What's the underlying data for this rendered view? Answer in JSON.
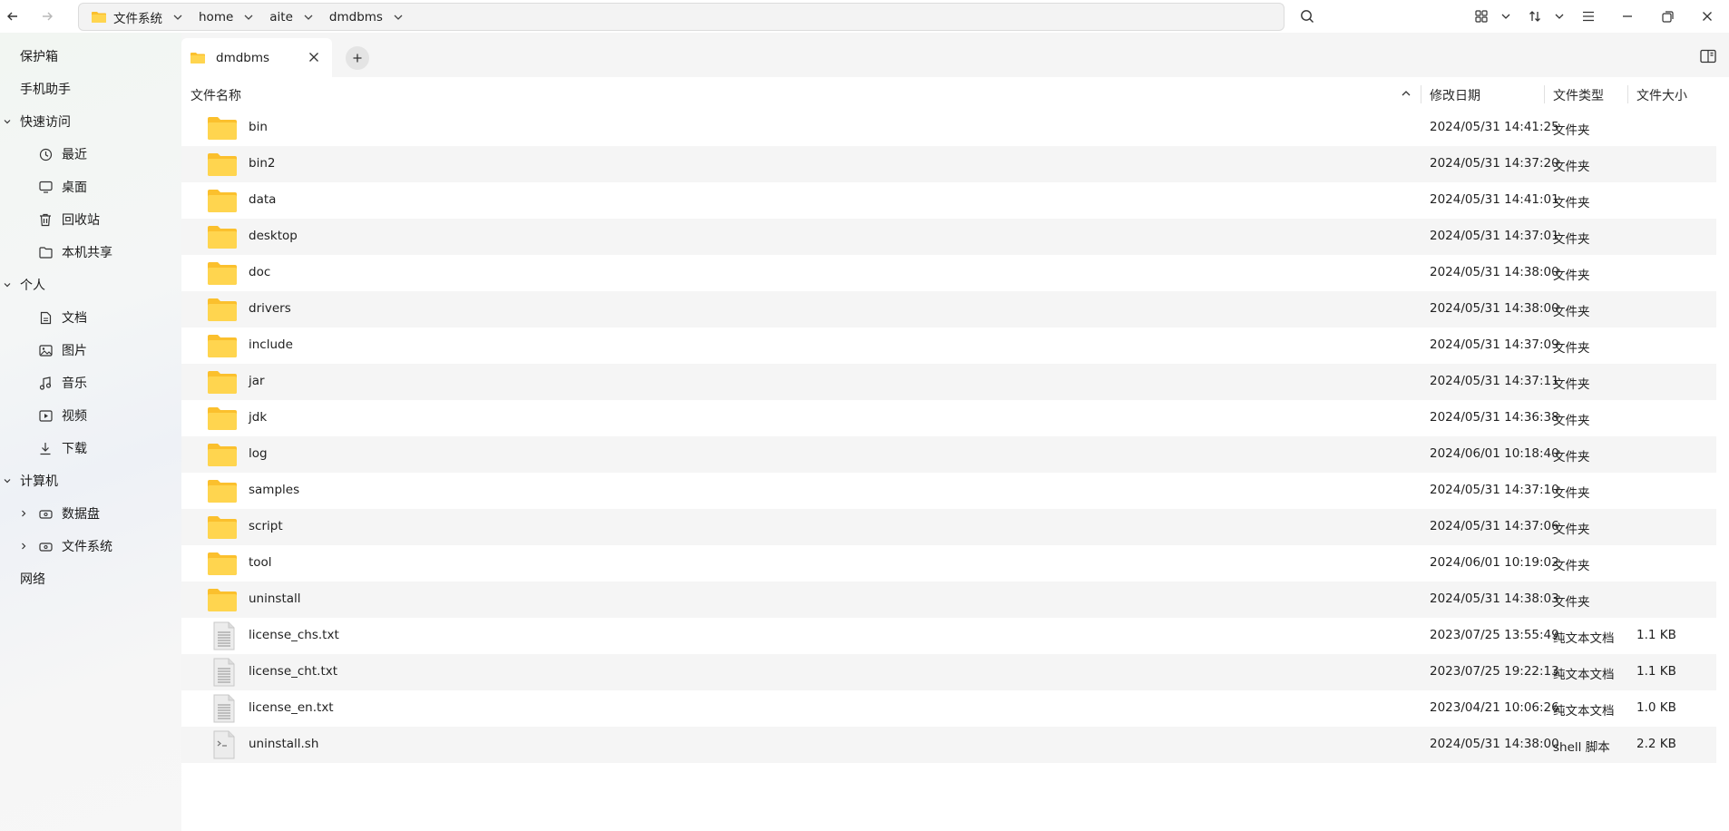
{
  "topbar": {
    "crumbs": [
      "文件系统",
      "home",
      "aite",
      "dmdbms"
    ]
  },
  "sidebar": {
    "items": [
      {
        "label": "保护箱"
      },
      {
        "label": "手机助手"
      },
      {
        "label": "快速访问"
      },
      {
        "label": "最近"
      },
      {
        "label": "桌面"
      },
      {
        "label": "回收站"
      },
      {
        "label": "本机共享"
      },
      {
        "label": "个人"
      },
      {
        "label": "文档"
      },
      {
        "label": "图片"
      },
      {
        "label": "音乐"
      },
      {
        "label": "视频"
      },
      {
        "label": "下载"
      },
      {
        "label": "计算机"
      },
      {
        "label": "数据盘"
      },
      {
        "label": "文件系统"
      },
      {
        "label": "网络"
      }
    ]
  },
  "tabs": [
    {
      "label": "dmdbms"
    }
  ],
  "columns": {
    "name": "文件名称",
    "date": "修改日期",
    "type": "文件类型",
    "size": "文件大小"
  },
  "files": [
    {
      "name": "bin",
      "date": "2024/05/31 14:41:25",
      "type": "文件夹",
      "size": ""
    },
    {
      "name": "bin2",
      "date": "2024/05/31 14:37:20",
      "type": "文件夹",
      "size": ""
    },
    {
      "name": "data",
      "date": "2024/05/31 14:41:01",
      "type": "文件夹",
      "size": ""
    },
    {
      "name": "desktop",
      "date": "2024/05/31 14:37:01",
      "type": "文件夹",
      "size": ""
    },
    {
      "name": "doc",
      "date": "2024/05/31 14:38:00",
      "type": "文件夹",
      "size": ""
    },
    {
      "name": "drivers",
      "date": "2024/05/31 14:38:00",
      "type": "文件夹",
      "size": ""
    },
    {
      "name": "include",
      "date": "2024/05/31 14:37:09",
      "type": "文件夹",
      "size": ""
    },
    {
      "name": "jar",
      "date": "2024/05/31 14:37:11",
      "type": "文件夹",
      "size": ""
    },
    {
      "name": "jdk",
      "date": "2024/05/31 14:36:38",
      "type": "文件夹",
      "size": ""
    },
    {
      "name": "log",
      "date": "2024/06/01 10:18:40",
      "type": "文件夹",
      "size": ""
    },
    {
      "name": "samples",
      "date": "2024/05/31 14:37:10",
      "type": "文件夹",
      "size": ""
    },
    {
      "name": "script",
      "date": "2024/05/31 14:37:06",
      "type": "文件夹",
      "size": ""
    },
    {
      "name": "tool",
      "date": "2024/06/01 10:19:02",
      "type": "文件夹",
      "size": ""
    },
    {
      "name": "uninstall",
      "date": "2024/05/31 14:38:03",
      "type": "文件夹",
      "size": ""
    },
    {
      "name": "license_chs.txt",
      "date": "2023/07/25 13:55:49",
      "type": "纯文本文档",
      "size": "1.1 KB"
    },
    {
      "name": "license_cht.txt",
      "date": "2023/07/25 19:22:13",
      "type": "纯文本文档",
      "size": "1.1 KB"
    },
    {
      "name": "license_en.txt",
      "date": "2023/04/21 10:06:26",
      "type": "纯文本文档",
      "size": "1.0 KB"
    },
    {
      "name": "uninstall.sh",
      "date": "2024/05/31 14:38:00",
      "type": "shell 脚本",
      "size": "2.2 KB"
    }
  ],
  "colors": {
    "folder": "#fbc02d",
    "folder_light": "#ffd54f",
    "row_alt": "#f5f5f5"
  }
}
